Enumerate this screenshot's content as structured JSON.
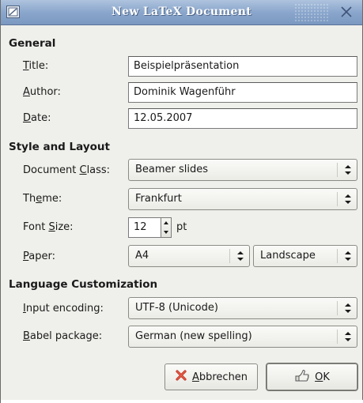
{
  "window": {
    "title": "New LaTeX Document",
    "menu_icon": "window-menu-icon",
    "close_icon": "close-icon"
  },
  "general": {
    "heading": "General",
    "title_label_mnemonic": "T",
    "title_label_rest": "itle:",
    "title_value": "Beispielpräsentation",
    "author_label_mnemonic": "A",
    "author_label_rest": "uthor:",
    "author_value": "Dominik Wagenführ",
    "date_label_mnemonic": "D",
    "date_label_rest": "ate:",
    "date_value": "12.05.2007"
  },
  "style": {
    "heading": "Style and Layout",
    "class_label_pre": "Document ",
    "class_label_mnemonic": "C",
    "class_label_rest": "lass:",
    "class_value": "Beamer slides",
    "theme_label_pre": "Th",
    "theme_label_mnemonic": "e",
    "theme_label_rest": "me:",
    "theme_value": "Frankfurt",
    "fontsize_label_pre": "Font ",
    "fontsize_label_mnemonic": "S",
    "fontsize_label_rest": "ize:",
    "fontsize_value": "12",
    "fontsize_unit": "pt",
    "paper_label_mnemonic": "P",
    "paper_label_rest": "aper:",
    "paper_value": "A4",
    "orientation_value": "Landscape"
  },
  "language": {
    "heading": "Language Customization",
    "encoding_label_mnemonic": "I",
    "encoding_label_rest": "nput encoding:",
    "encoding_value": "UTF-8 (Unicode)",
    "babel_label_mnemonic": "B",
    "babel_label_rest": "abel package:",
    "babel_value": "German (new spelling)"
  },
  "buttons": {
    "cancel_mnemonic": "A",
    "cancel_rest": "bbrechen",
    "cancel_icon": "cancel-x-icon",
    "ok_mnemonic": "O",
    "ok_rest": "K",
    "ok_icon": "ok-hand-icon"
  }
}
